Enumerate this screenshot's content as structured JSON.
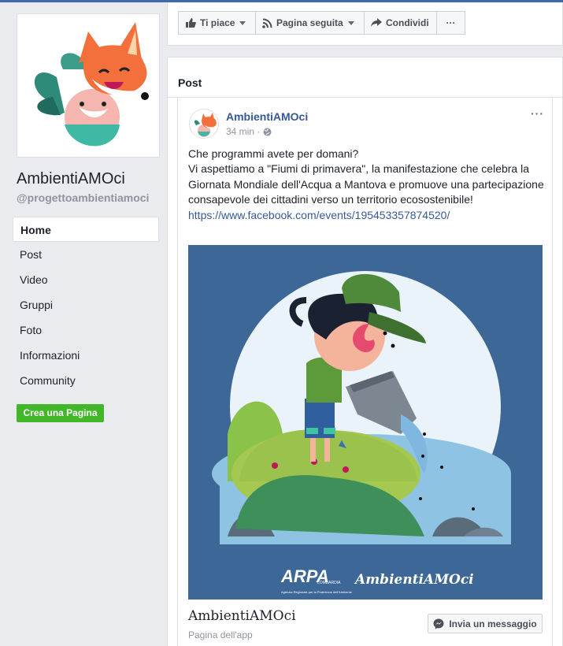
{
  "sidebar": {
    "page_name": "AmbientiAMOci",
    "page_handle": "@progettoambientiamoci",
    "nav": [
      {
        "label": "Home",
        "active": true
      },
      {
        "label": "Post"
      },
      {
        "label": "Video"
      },
      {
        "label": "Gruppi"
      },
      {
        "label": "Foto"
      },
      {
        "label": "Informazioni"
      },
      {
        "label": "Community"
      }
    ],
    "create_page_label": "Crea una Pagina"
  },
  "actions": {
    "like_label": "Ti piace",
    "follow_label": "Pagina seguita",
    "share_label": "Condividi",
    "more_label": "···"
  },
  "posts_section": {
    "title": "Post"
  },
  "post": {
    "author": "AmbientiAMOci",
    "time": "34 min ·",
    "options": "···",
    "text_lines": [
      "Che programmi avete per domani?",
      "Vi aspettiamo a \"Fiumi di primavera\", la manifestazione che celebra la Giornata Mondiale dell'Acqua a Mantova e promuove una partecipazione consapevole dei cittadini verso un territorio ecosostenibile!"
    ],
    "link": "https://www.facebook.com/events/195453357874520/",
    "image_logo_text": "ARPA",
    "image_logo_sub": "LOMBARDIA",
    "image_logo_tagline": "Agenzia Regionale per la Protezione dell'Ambiente",
    "image_brand_text": "AmbientiAMOci"
  },
  "app_card": {
    "name": "AmbientiAMOci",
    "subtitle": "Pagina dell'app",
    "message_label": "Invia un messaggio"
  },
  "colors": {
    "facebook_blue": "#4267b2",
    "link_blue": "#365899",
    "green_button": "#42b72a",
    "illustration_bg": "#3c6796"
  }
}
